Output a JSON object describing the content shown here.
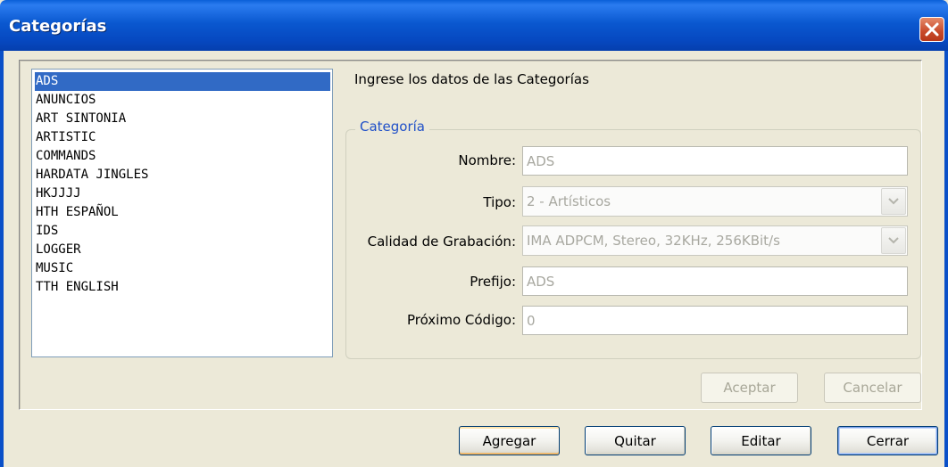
{
  "window": {
    "title": "Categorías"
  },
  "categories": {
    "items": [
      "ADS",
      "ANUNCIOS",
      "ART SINTONIA",
      "ARTISTIC",
      "COMMANDS",
      "HARDATA JINGLES",
      "HKJJJJ",
      "HTH ESPAÑOL",
      "IDS",
      "LOGGER",
      "MUSIC",
      "TTH ENGLISH"
    ],
    "selected": "ADS"
  },
  "form": {
    "intro": "Ingrese los datos de las Categorías",
    "group_title": "Categoría",
    "nombre": {
      "label": "Nombre:",
      "value": "ADS"
    },
    "tipo": {
      "label": "Tipo:",
      "value": "2 - Artísticos"
    },
    "calidad": {
      "label": "Calidad de Grabación:",
      "value": "IMA ADPCM, Stereo, 32KHz, 256KBit/s"
    },
    "prefijo": {
      "label": "Prefijo:",
      "value": "ADS"
    },
    "proximo": {
      "label": "Próximo Código:",
      "value": "0"
    },
    "aceptar_label": "Aceptar",
    "cancelar_label": "Cancelar"
  },
  "footer": {
    "agregar_label": "Agregar",
    "quitar_label": "Quitar",
    "editar_label": "Editar",
    "cerrar_label": "Cerrar"
  },
  "colors": {
    "selection": "#316ac5",
    "titlebar": "#0a5fd8",
    "group_title": "#2050c8",
    "close_button": "#c84a2a"
  }
}
